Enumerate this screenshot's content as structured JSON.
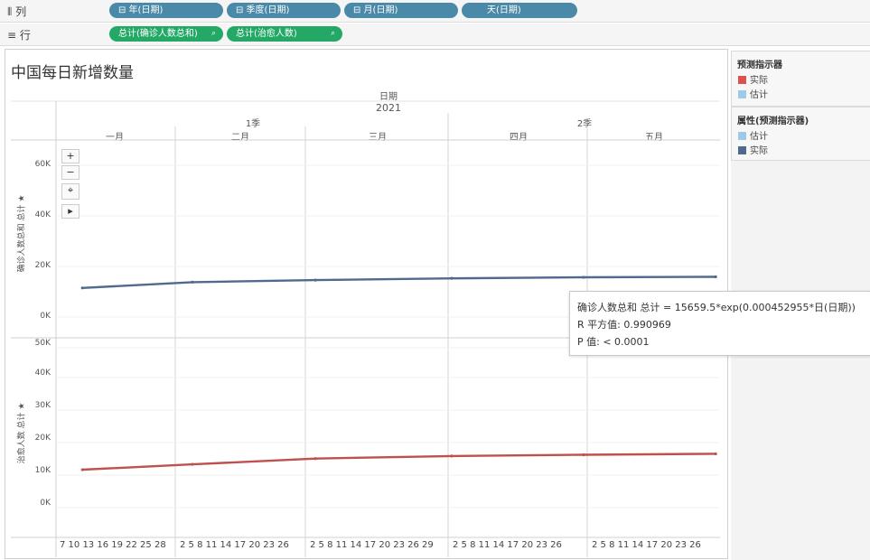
{
  "shelves": {
    "columns": {
      "label": "列",
      "pills": [
        "⊟ 年(日期)",
        "⊟ 季度(日期)",
        "⊟ 月(日期)",
        "天(日期)"
      ]
    },
    "rows": {
      "label": "行",
      "pills": [
        "总计(确诊人数总和)",
        "总计(治愈人数)"
      ]
    }
  },
  "view": {
    "title": "中国每日新增数量",
    "field_header": "日期",
    "year": "2021",
    "quarters": [
      "1季",
      "2季"
    ],
    "months": [
      "一月",
      "二月",
      "三月",
      "四月",
      "五月"
    ],
    "panes": [
      {
        "ytitle": "确诊人数总和 总计",
        "ticks": [
          "60K",
          "40K",
          "20K",
          "0K"
        ]
      },
      {
        "ytitle": "治愈人数 总计",
        "ticks": [
          "50K",
          "40K",
          "30K",
          "20K",
          "10K",
          "0K"
        ]
      }
    ],
    "day_ticks": [
      "7 10 13 16 19 22 25 28",
      "2  5  8 11 14 17 20 23 26",
      "2  5  8 11 14 17 20 23 26 29",
      "2  5  8 11 14 17 20 23 26",
      "2  5  8 11 14 17 20 23 26"
    ],
    "zoom": [
      "+",
      "−",
      "⌖",
      "▸"
    ]
  },
  "chart_data": {
    "type": "line",
    "x": [
      "2021-01-07",
      "2021-02-01",
      "2021-03-01",
      "2021-04-01",
      "2021-05-01",
      "2021-05-31"
    ],
    "series": [
      {
        "name": "确诊人数总和 总计",
        "values": [
          11500,
          13800,
          14600,
          15300,
          15700,
          15900
        ],
        "color": "#4e6b8e",
        "ylim": [
          -2000,
          65000
        ]
      },
      {
        "name": "治愈人数 总计",
        "values": [
          10500,
          12200,
          14000,
          14800,
          15200,
          15500
        ],
        "color": "#c0504d",
        "ylim": [
          -2000,
          52000
        ]
      }
    ]
  },
  "tooltip": {
    "line1": "确诊人数总和 总计 = 15659.5*exp(0.000452955*日(日期))",
    "line2": "R 平方值: 0.990969",
    "line3": "P 值: < 0.0001"
  },
  "legends": [
    {
      "title": "预测指示器",
      "items": [
        {
          "label": "实际",
          "color": "#d9534f"
        },
        {
          "label": "估计",
          "color": "#9ec9e8"
        }
      ]
    },
    {
      "title": "属性(预测指示器)",
      "items": [
        {
          "label": "估计",
          "color": "#9ec9e8"
        },
        {
          "label": "实际",
          "color": "#4e6b8e"
        }
      ]
    }
  ]
}
